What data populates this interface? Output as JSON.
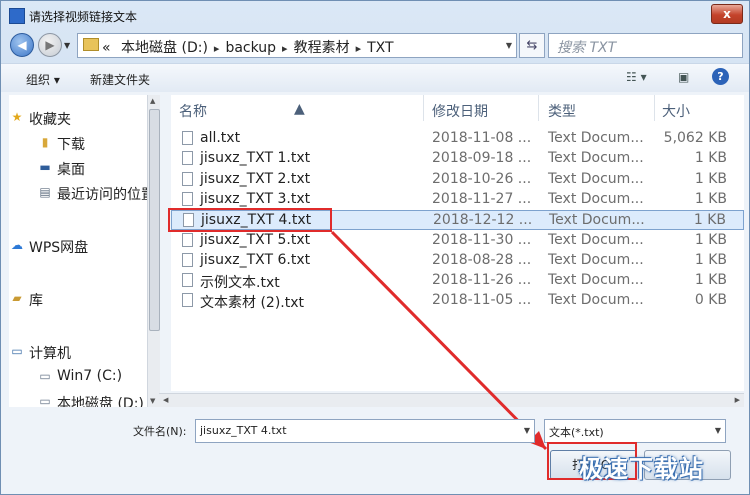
{
  "window": {
    "title": "请选择视频链接文本",
    "close": "x"
  },
  "address": {
    "prefix": "«",
    "segments": [
      "本地磁盘 (D:)",
      "backup",
      "教程素材",
      "TXT"
    ],
    "search_placeholder": "搜索 TXT"
  },
  "toolbar": {
    "organize": "组织 ▾",
    "new_folder": "新建文件夹",
    "help": "?"
  },
  "sidebar": {
    "favorites": "收藏夹",
    "downloads": "下载",
    "desktop": "桌面",
    "recent": "最近访问的位置",
    "wps": "WPS网盘",
    "library": "库",
    "computer": "计算机",
    "win7": "Win7 (C:)",
    "local_d": "本地磁盘 (D:)"
  },
  "columns": {
    "name": "名称",
    "modified": "修改日期",
    "type": "类型",
    "size": "大小"
  },
  "files": [
    {
      "name": "all.txt",
      "date": "2018-11-08 ...",
      "type": "Text Docum...",
      "size": "5,062 KB"
    },
    {
      "name": "jisuxz_TXT 1.txt",
      "date": "2018-09-18 ...",
      "type": "Text Docum...",
      "size": "1 KB"
    },
    {
      "name": "jisuxz_TXT 2.txt",
      "date": "2018-10-26 ...",
      "type": "Text Docum...",
      "size": "1 KB"
    },
    {
      "name": "jisuxz_TXT 3.txt",
      "date": "2018-11-27 ...",
      "type": "Text Docum...",
      "size": "1 KB"
    },
    {
      "name": "jisuxz_TXT 4.txt",
      "date": "2018-12-12 ...",
      "type": "Text Docum...",
      "size": "1 KB"
    },
    {
      "name": "jisuxz_TXT 5.txt",
      "date": "2018-11-30 ...",
      "type": "Text Docum...",
      "size": "1 KB"
    },
    {
      "name": "jisuxz_TXT 6.txt",
      "date": "2018-08-28 ...",
      "type": "Text Docum...",
      "size": "1 KB"
    },
    {
      "name": "示例文本.txt",
      "date": "2018-11-26 ...",
      "type": "Text Docum...",
      "size": "1 KB"
    },
    {
      "name": "文本素材 (2).txt",
      "date": "2018-11-05 ...",
      "type": "Text Docum...",
      "size": "0 KB"
    }
  ],
  "selected_index": 4,
  "bottom": {
    "filename_label": "文件名(N):",
    "filename_value": "jisuxz_TXT 4.txt",
    "filter_value": "文本(*.txt)",
    "open_label": "打开(O)",
    "cancel_label": ""
  },
  "watermark": "极速下载站",
  "colors": {
    "highlight": "#e02b2b",
    "selection": "#dcebfc"
  }
}
